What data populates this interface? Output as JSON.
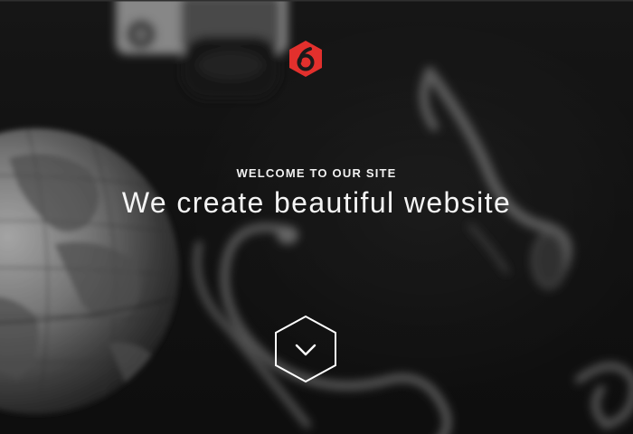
{
  "hero": {
    "eyebrow": "WELCOME TO OUR SITE",
    "headline": "We create beautiful website"
  },
  "logo": {
    "icon": "hexagon-six-logo",
    "glyph": "6",
    "color": "#e2302d"
  },
  "scroll_button": {
    "icon": "chevron-down-icon"
  },
  "background": {
    "objects": [
      "globe",
      "camera",
      "headphones-cable"
    ]
  }
}
